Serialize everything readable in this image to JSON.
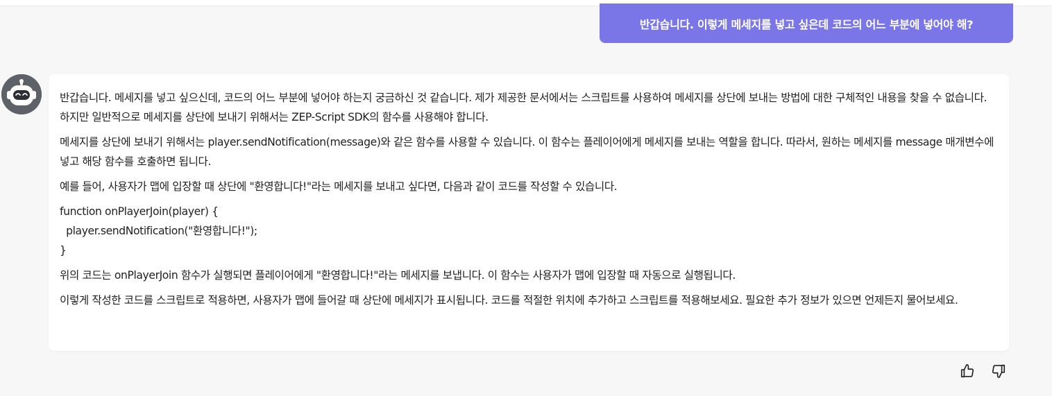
{
  "user_message": "반갑습니다. 이렇게 메세지를  넣고 싶은데 코드의 어느 부분에 넣어야 해?",
  "bot": {
    "paragraphs": [
      "반갑습니다. 메세지를 넣고 싶으신데, 코드의 어느 부분에 넣어야 하는지 궁금하신 것 같습니다. 제가 제공한 문서에서는 스크립트를 사용하여 메세지를 상단에 보내는 방법에 대한 구체적인 내용을 찾을 수 없습니다. 하지만 일반적으로 메세지를 상단에 보내기 위해서는 ZEP-Script SDK의 함수를 사용해야 합니다.",
      "메세지를 상단에 보내기 위해서는 player.sendNotification(message)와 같은 함수를 사용할 수 있습니다. 이 함수는 플레이어에게 메세지를 보내는 역할을 합니다. 따라서, 원하는 메세지를 message 매개변수에 넣고 해당 함수를 호출하면 됩니다.",
      "예를 들어, 사용자가 맵에 입장할 때 상단에 \"환영합니다!\"라는 메세지를 보내고 싶다면, 다음과 같이 코드를 작성할 수 있습니다.",
      "위의 코드는 onPlayerJoin 함수가 실행되면 플레이어에게 \"환영합니다!\"라는 메세지를 보냅니다. 이 함수는 사용자가 맵에 입장할 때 자동으로 실행됩니다.",
      "이렇게 작성한 코드를 스크립트로 적용하면, 사용자가 맵에 들어갈 때 상단에 메세지가 표시됩니다. 코드를 적절한 위치에 추가하고 스크립트를 적용해보세요. 필요한 추가 정보가 있으면 언제든지 물어보세요."
    ],
    "code_lines": [
      "function onPlayerJoin(player) {",
      "  player.sendNotification(\"환영합니다!\");",
      "}"
    ]
  },
  "icons": {
    "avatar": "robot-avatar-icon",
    "like": "thumbs-up-icon",
    "dislike": "thumbs-down-icon"
  },
  "colors": {
    "user_bubble": "#7b76e8",
    "background": "#f7f7f8",
    "card": "#ffffff",
    "avatar": "#5d6168"
  }
}
